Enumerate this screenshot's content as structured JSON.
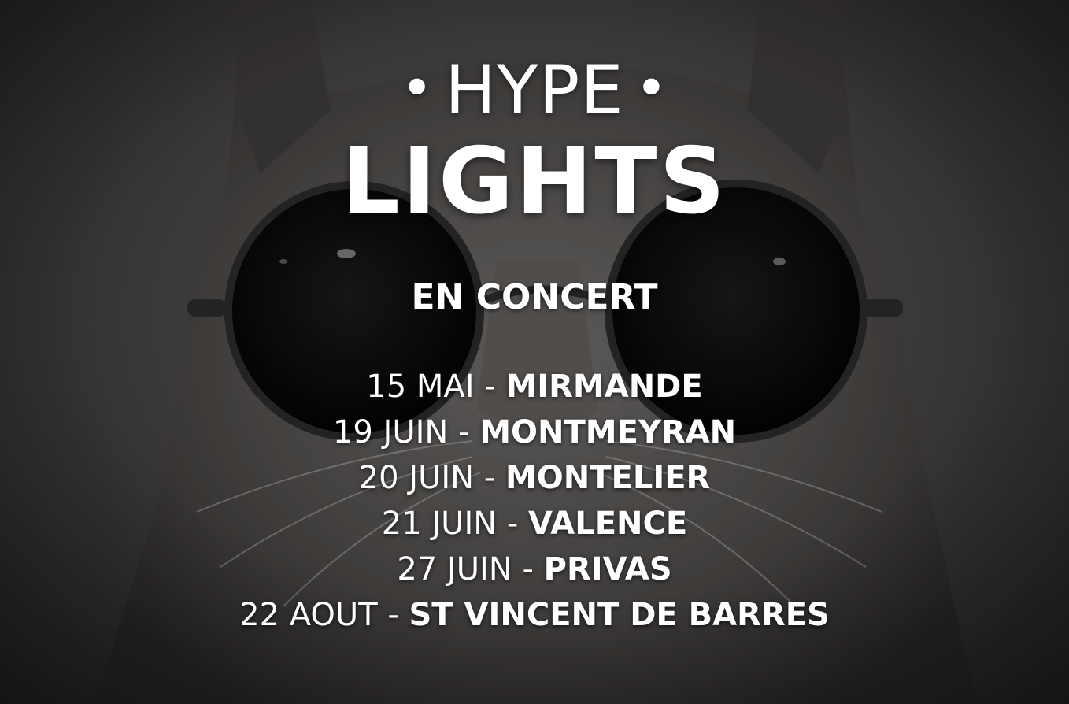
{
  "poster": {
    "title_top": "HYPE",
    "title_dot": "•",
    "title_main": "LIGHTS",
    "subtitle": "EN CONCERT",
    "dates": [
      {
        "date": "15 MAI - ",
        "city": "MIRMANDE"
      },
      {
        "date": "19 JUIN - ",
        "city": "MONTMEYRAN"
      },
      {
        "date": "20 JUIN - ",
        "city": "MONTELIER"
      },
      {
        "date": "21 JUIN - ",
        "city": "VALENCE"
      },
      {
        "date": "27 JUIN - ",
        "city": "PRIVAS"
      },
      {
        "date": "22 AOUT - ",
        "city": "ST VINCENT DE BARRES"
      }
    ]
  },
  "colors": {
    "text": "#ffffff",
    "background": "#4a4847"
  }
}
